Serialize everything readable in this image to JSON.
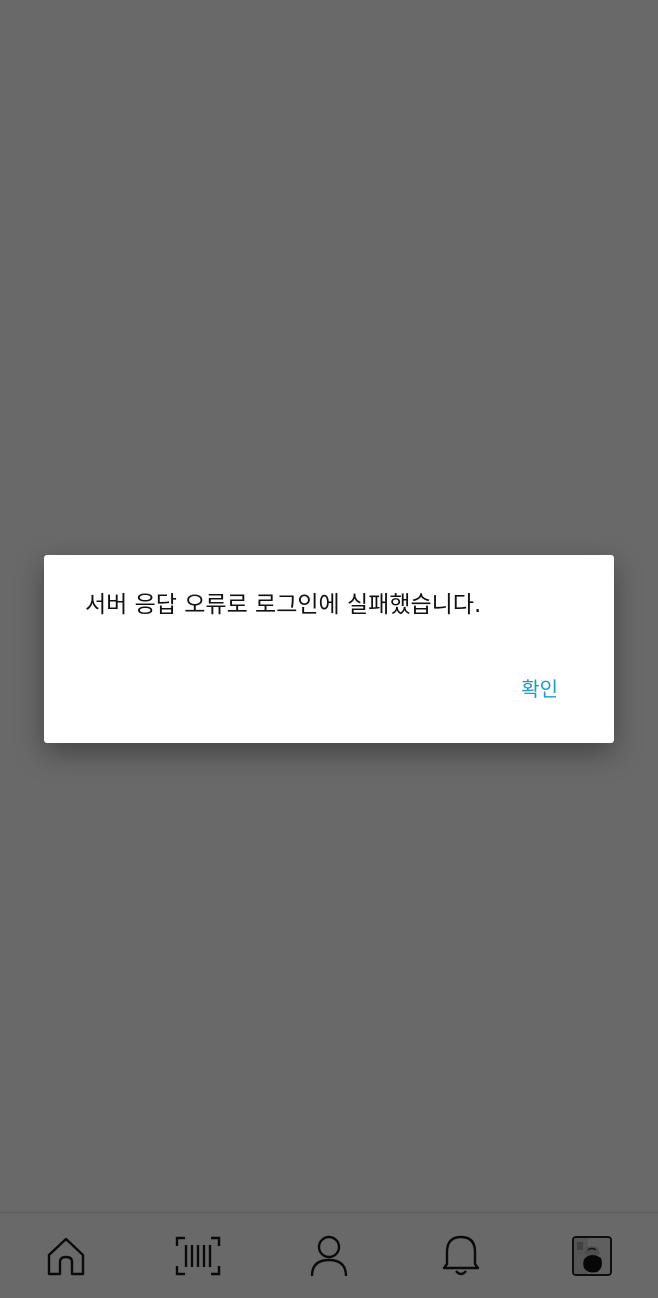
{
  "dialog": {
    "message": "서버 응답 오류로 로그인에 실패했습니다.",
    "ok_label": "확인"
  },
  "bottom_nav": {
    "items": [
      {
        "icon": "home-icon"
      },
      {
        "icon": "barcode-scan-icon"
      },
      {
        "icon": "user-icon"
      },
      {
        "icon": "bell-icon"
      },
      {
        "icon": "profile-photo"
      }
    ]
  },
  "colors": {
    "accent": "#1a9bcf",
    "scrim": "rgba(0,0,0,0.588)"
  }
}
